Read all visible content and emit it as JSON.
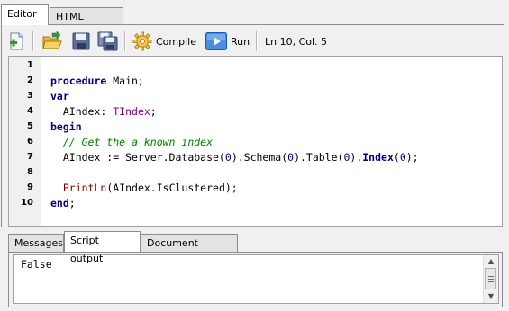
{
  "top_tabs": [
    {
      "label": "Editor",
      "active": true
    },
    {
      "label": "HTML output",
      "active": false
    }
  ],
  "toolbar": {
    "new_icon": "new-document-plus",
    "open_icon": "open-folder",
    "save_icon": "floppy-disk",
    "save_all_icon": "save-all-floppies",
    "compile_icon": "gear",
    "compile_label": "Compile",
    "run_icon": "play",
    "run_label": "Run",
    "status": "Ln 10, Col. 5"
  },
  "editor": {
    "line_numbers": [
      "1",
      "2",
      "3",
      "4",
      "5",
      "6",
      "7",
      "8",
      "9",
      "10"
    ],
    "lines": [
      [],
      [
        {
          "t": "procedure",
          "c": "kw"
        },
        {
          "t": " Main;",
          "c": "pl"
        }
      ],
      [
        {
          "t": "var",
          "c": "kw"
        }
      ],
      [
        {
          "t": "  AIndex: ",
          "c": "pl"
        },
        {
          "t": "TIndex",
          "c": "ty"
        },
        {
          "t": ";",
          "c": "pl"
        }
      ],
      [
        {
          "t": "begin",
          "c": "kw"
        }
      ],
      [
        {
          "t": "  // Get the a known index",
          "c": "cm"
        }
      ],
      [
        {
          "t": "  AIndex := Server.Database(",
          "c": "pl"
        },
        {
          "t": "0",
          "c": "nm"
        },
        {
          "t": ").Schema(",
          "c": "pl"
        },
        {
          "t": "0",
          "c": "nm"
        },
        {
          "t": ").Table(",
          "c": "pl"
        },
        {
          "t": "0",
          "c": "nm"
        },
        {
          "t": ").",
          "c": "pl"
        },
        {
          "t": "Index",
          "c": "bd"
        },
        {
          "t": "(",
          "c": "pl"
        },
        {
          "t": "0",
          "c": "nm"
        },
        {
          "t": ");",
          "c": "pl"
        }
      ],
      [],
      [
        {
          "t": "  ",
          "c": "pl"
        },
        {
          "t": "PrintLn",
          "c": "pr"
        },
        {
          "t": "(AIndex.IsClustered);",
          "c": "pl"
        }
      ],
      [
        {
          "t": "end",
          "c": "kw"
        },
        {
          "t": ";",
          "c": "pl"
        }
      ]
    ]
  },
  "bottom_tabs": [
    {
      "label": "Messages",
      "active": false
    },
    {
      "label": "Script output",
      "active": true
    },
    {
      "label": "Document settings",
      "active": false
    }
  ],
  "output": {
    "text": "False"
  },
  "colors": {
    "keyword": "#000080",
    "type": "#800080",
    "comment": "#008000",
    "builtin": "#800000",
    "number": "#000080"
  }
}
